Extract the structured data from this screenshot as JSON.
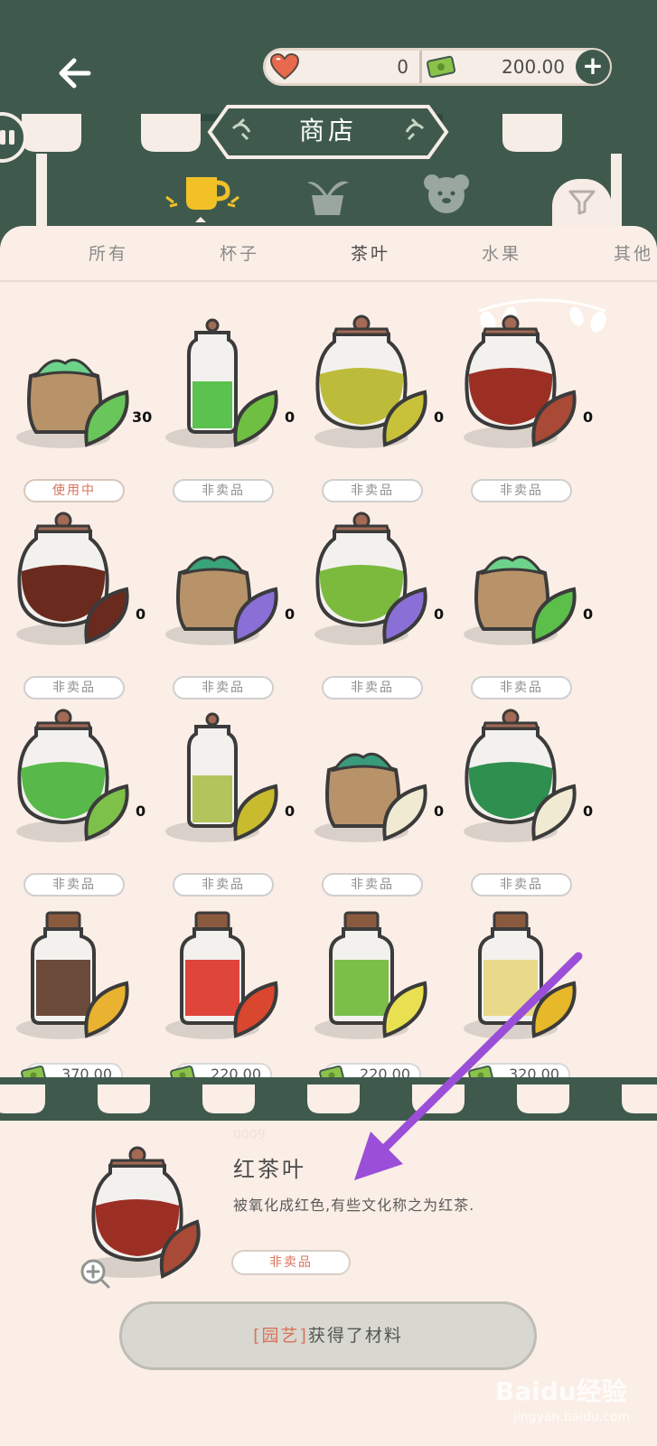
{
  "header": {
    "hearts": "0",
    "money": "200.00",
    "shop_title": "商店"
  },
  "tabs": [
    {
      "label": "所有"
    },
    {
      "label": "杯子"
    },
    {
      "label": "茶叶"
    },
    {
      "label": "水果"
    },
    {
      "label": "其他"
    }
  ],
  "items": [
    {
      "count": "30",
      "tag": "使用中"
    },
    {
      "count": "0",
      "tag": "非卖品"
    },
    {
      "count": "0",
      "tag": "非卖品"
    },
    {
      "count": "0",
      "tag": "非卖品"
    },
    {
      "count": "0",
      "tag": "非卖品"
    },
    {
      "count": "0",
      "tag": "非卖品"
    },
    {
      "count": "0",
      "tag": "非卖品"
    },
    {
      "count": "0",
      "tag": "非卖品"
    },
    {
      "count": "0",
      "tag": "非卖品"
    },
    {
      "count": "0",
      "tag": "非卖品"
    },
    {
      "count": "0",
      "tag": "非卖品"
    },
    {
      "count": "0",
      "tag": "非卖品"
    },
    {
      "price": "370.00"
    },
    {
      "price": "220.00"
    },
    {
      "price": "220.00"
    },
    {
      "price": "320.00"
    }
  ],
  "detail": {
    "faded_id": "0009",
    "name": "红茶叶",
    "description": "被氧化成红色,有些文化称之为红茶.",
    "tag": "非卖品",
    "button_prefix": "[园艺]",
    "button_text": "获得了材料"
  },
  "watermark": {
    "logo": "Baidu经验",
    "url": "jingyan.baidu.com"
  },
  "colors": {
    "primary": "#3f5a4d",
    "panel": "#fbeee6",
    "accent": "#d9735b",
    "arrow": "#9b4fd8"
  }
}
